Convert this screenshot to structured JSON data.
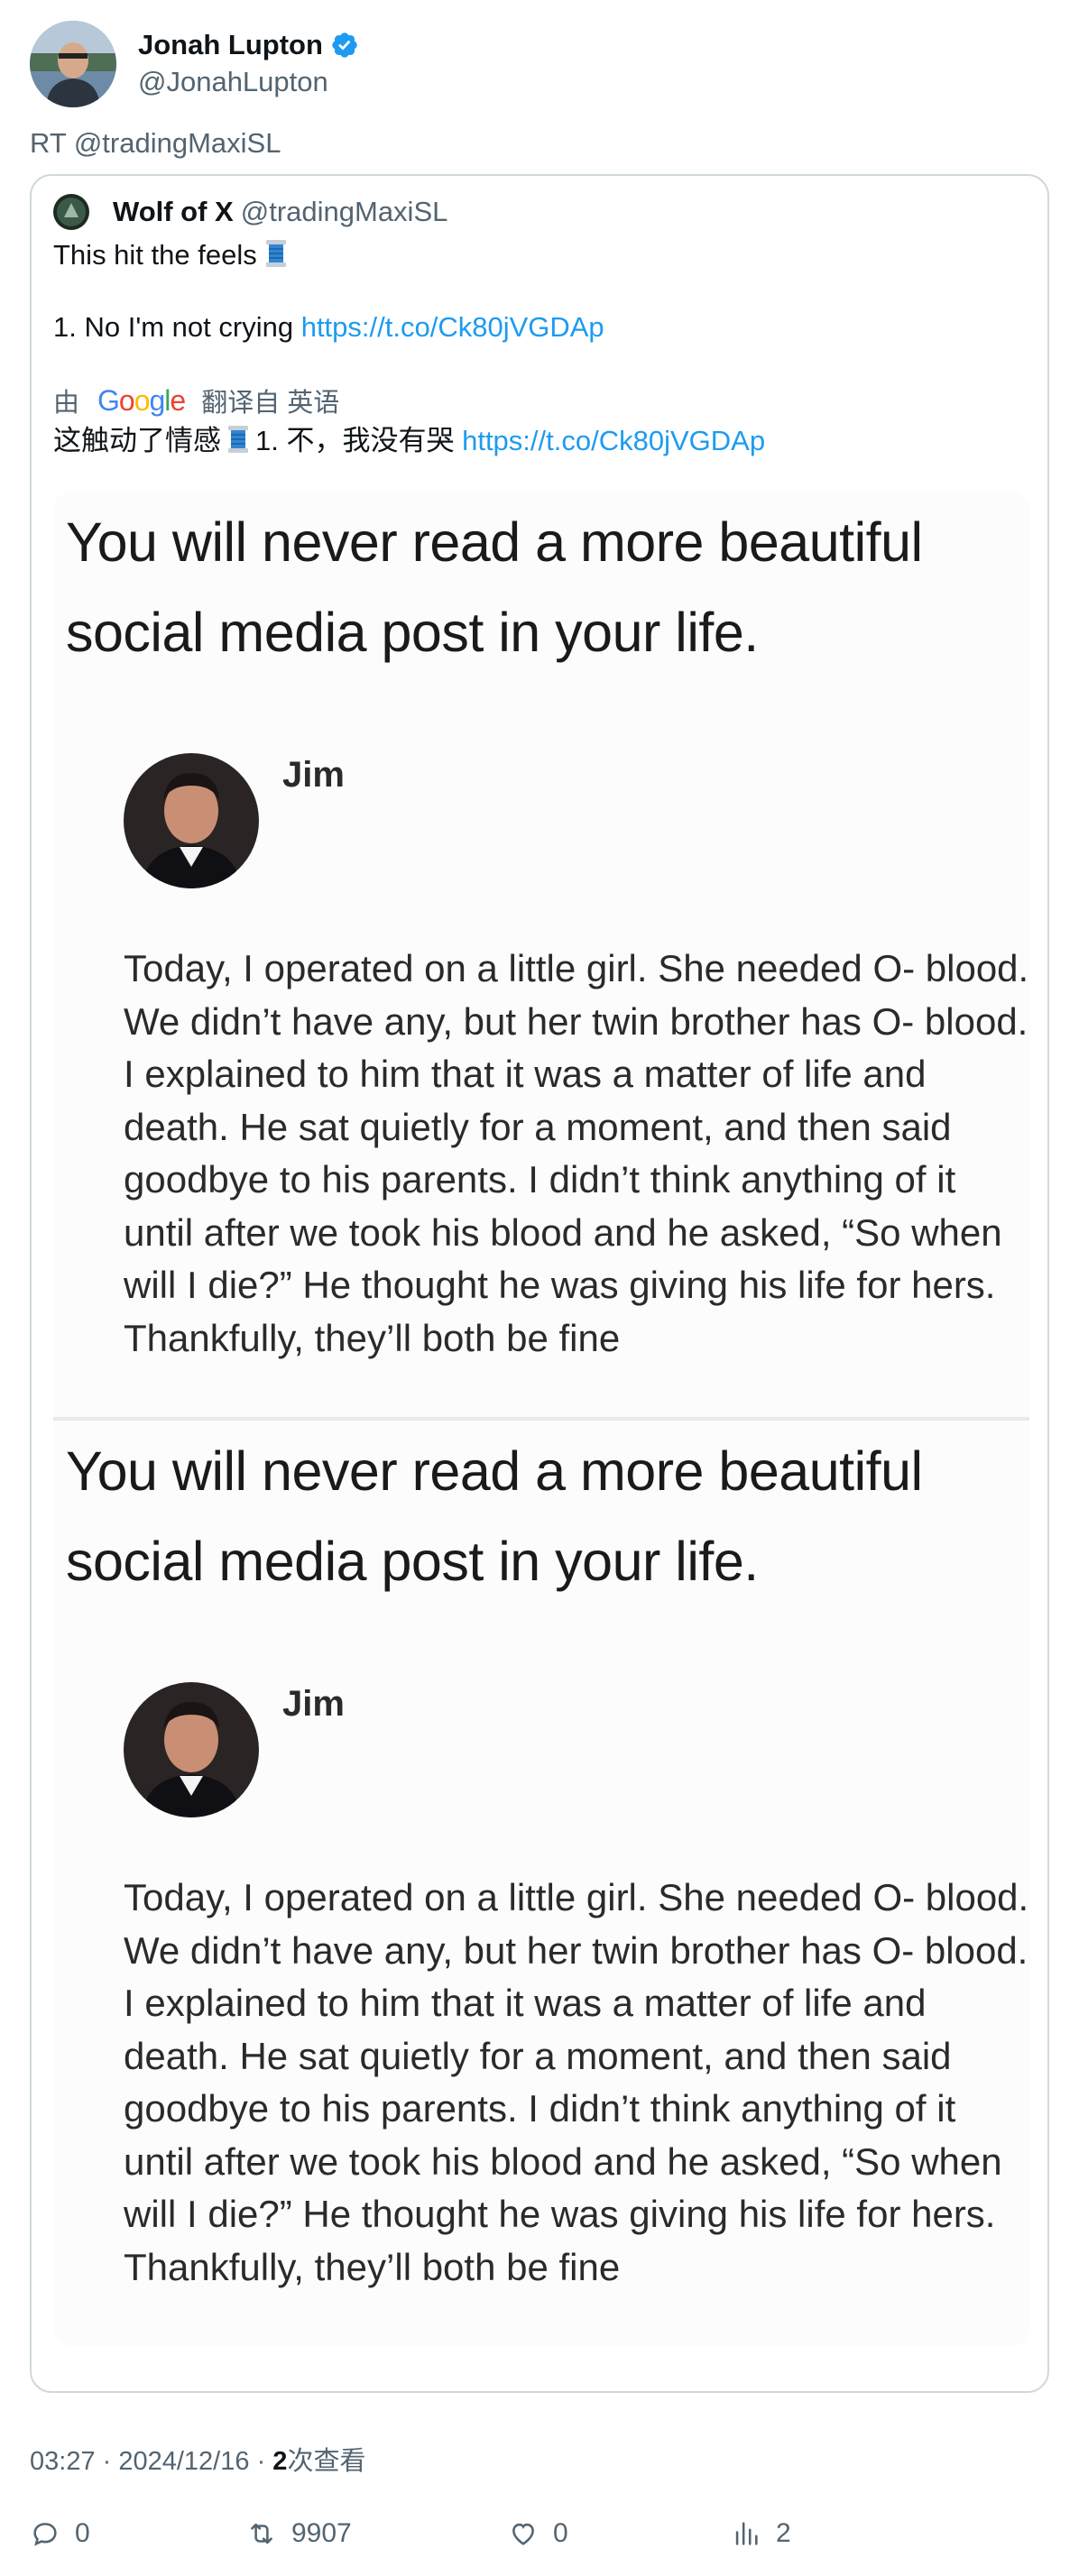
{
  "author": {
    "name": "Jonah Lupton",
    "handle": "@JonahLupton",
    "verified": true,
    "verified_color": "#1d9bf0"
  },
  "retweet_label": "RT @tradingMaxiSL",
  "quoted_tweet": {
    "name": "Wolf of X",
    "handle": "@tradingMaxiSL",
    "line1": "This hit the feels",
    "line2_prefix": "1. No I'm not crying",
    "link": "https://t.co/Ck80jVGDAp",
    "translation_by": "由",
    "translation_from": "翻译自 英语",
    "translated_prefix": "这触动了情感",
    "translated_suffix": "1. 不，我没有哭",
    "emoji": "spool-of-thread-icon"
  },
  "media": {
    "headline_line1": "You will never read a more beautiful",
    "headline_line2": "social media post in your life.",
    "poster_name": "Jim",
    "post_text": "Today, I operated on a little girl. She needed O- blood. We didn’t have any, but her twin brother has O- blood. I explained to him that it was a matter of life and death. He sat quietly for a moment, and then said goodbye to his parents. I didn’t think anything of it until after we took his blood and he asked, “So when will I die?” He thought he was giving his life for hers. Thankfully, they’ll both be fine"
  },
  "meta": {
    "time": "03:27",
    "date": "2024/12/16",
    "views_count": "2",
    "views_label": "次查看"
  },
  "actions": {
    "replies": "0",
    "retweets": "9907",
    "likes": "0",
    "views": "2"
  },
  "colors": {
    "link": "#1d9bf0",
    "secondary_text": "#536471",
    "border": "#cfd9de"
  }
}
